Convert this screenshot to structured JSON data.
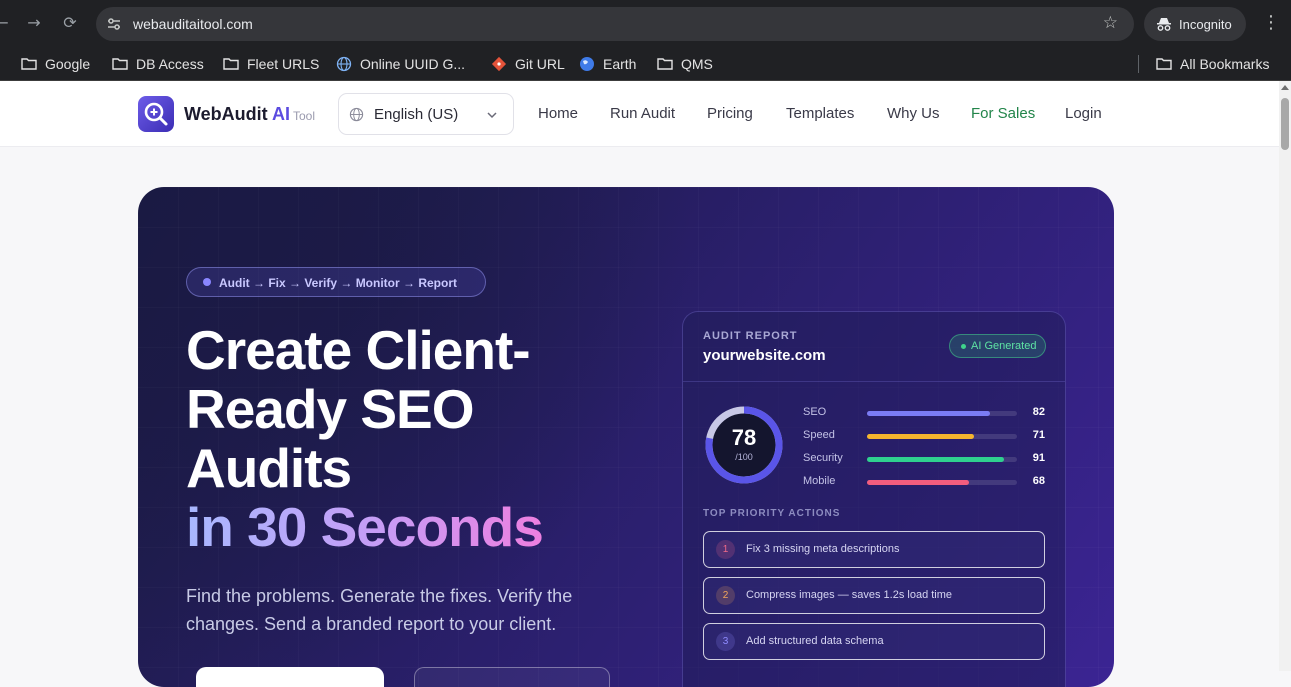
{
  "browser": {
    "url": "webauditaitool.com",
    "profile_label": "Incognito",
    "bookmarks": [
      {
        "label": "Google",
        "icon": "folder-icon"
      },
      {
        "label": "DB Access",
        "icon": "folder-icon"
      },
      {
        "label": "Fleet URLS",
        "icon": "folder-icon"
      },
      {
        "label": "Online UUID G...",
        "icon": "globe-icon"
      },
      {
        "label": "Git URL",
        "icon": "git-icon"
      },
      {
        "label": "Earth",
        "icon": "earth-icon"
      },
      {
        "label": "QMS",
        "icon": "folder-icon"
      }
    ],
    "all_bookmarks_label": "All Bookmarks"
  },
  "header": {
    "brand_name": "WebAudit",
    "brand_ai": "AI",
    "brand_tool": "Tool",
    "language": "English (US)",
    "nav": [
      "Home",
      "Run Audit",
      "Pricing",
      "Templates",
      "Why Us",
      "For Sales",
      "Login"
    ]
  },
  "hero": {
    "pill_text": "Audit → Fix → Verify → Monitor → Report",
    "headline_lines": [
      "Create Client-",
      "Ready SEO",
      "Audits"
    ],
    "headline_highlight": "in 30 Seconds",
    "subtext": "Find the problems. Generate the fixes. Verify the changes. Send a branded report to your client."
  },
  "report_card": {
    "label": "AUDIT REPORT",
    "site": "yourwebsite.com",
    "badge": "AI Generated",
    "score": "78",
    "score_of": "/100",
    "score_fraction": 0.78,
    "metrics": [
      {
        "label": "SEO",
        "value": 82,
        "color": "#7b7cf5"
      },
      {
        "label": "Speed",
        "value": 71,
        "color": "#f5b52e"
      },
      {
        "label": "Security",
        "value": 91,
        "color": "#2fd18f"
      },
      {
        "label": "Mobile",
        "value": 68,
        "color": "#f25d7e"
      }
    ],
    "actions_title": "TOP PRIORITY ACTIONS",
    "actions": [
      {
        "num": "1",
        "text": "Fix 3 missing meta descriptions",
        "color": "#f06a8a"
      },
      {
        "num": "2",
        "text": "Compress images — saves 1.2s load time",
        "color": "#f2a65a"
      },
      {
        "num": "3",
        "text": "Add structured data schema",
        "color": "#8f8cff"
      }
    ]
  },
  "colors": {
    "accent": "#5b4be0",
    "sales_link": "#22854a",
    "ring_track": "#c8c8e6",
    "ring_fill": "#5a55e8"
  }
}
